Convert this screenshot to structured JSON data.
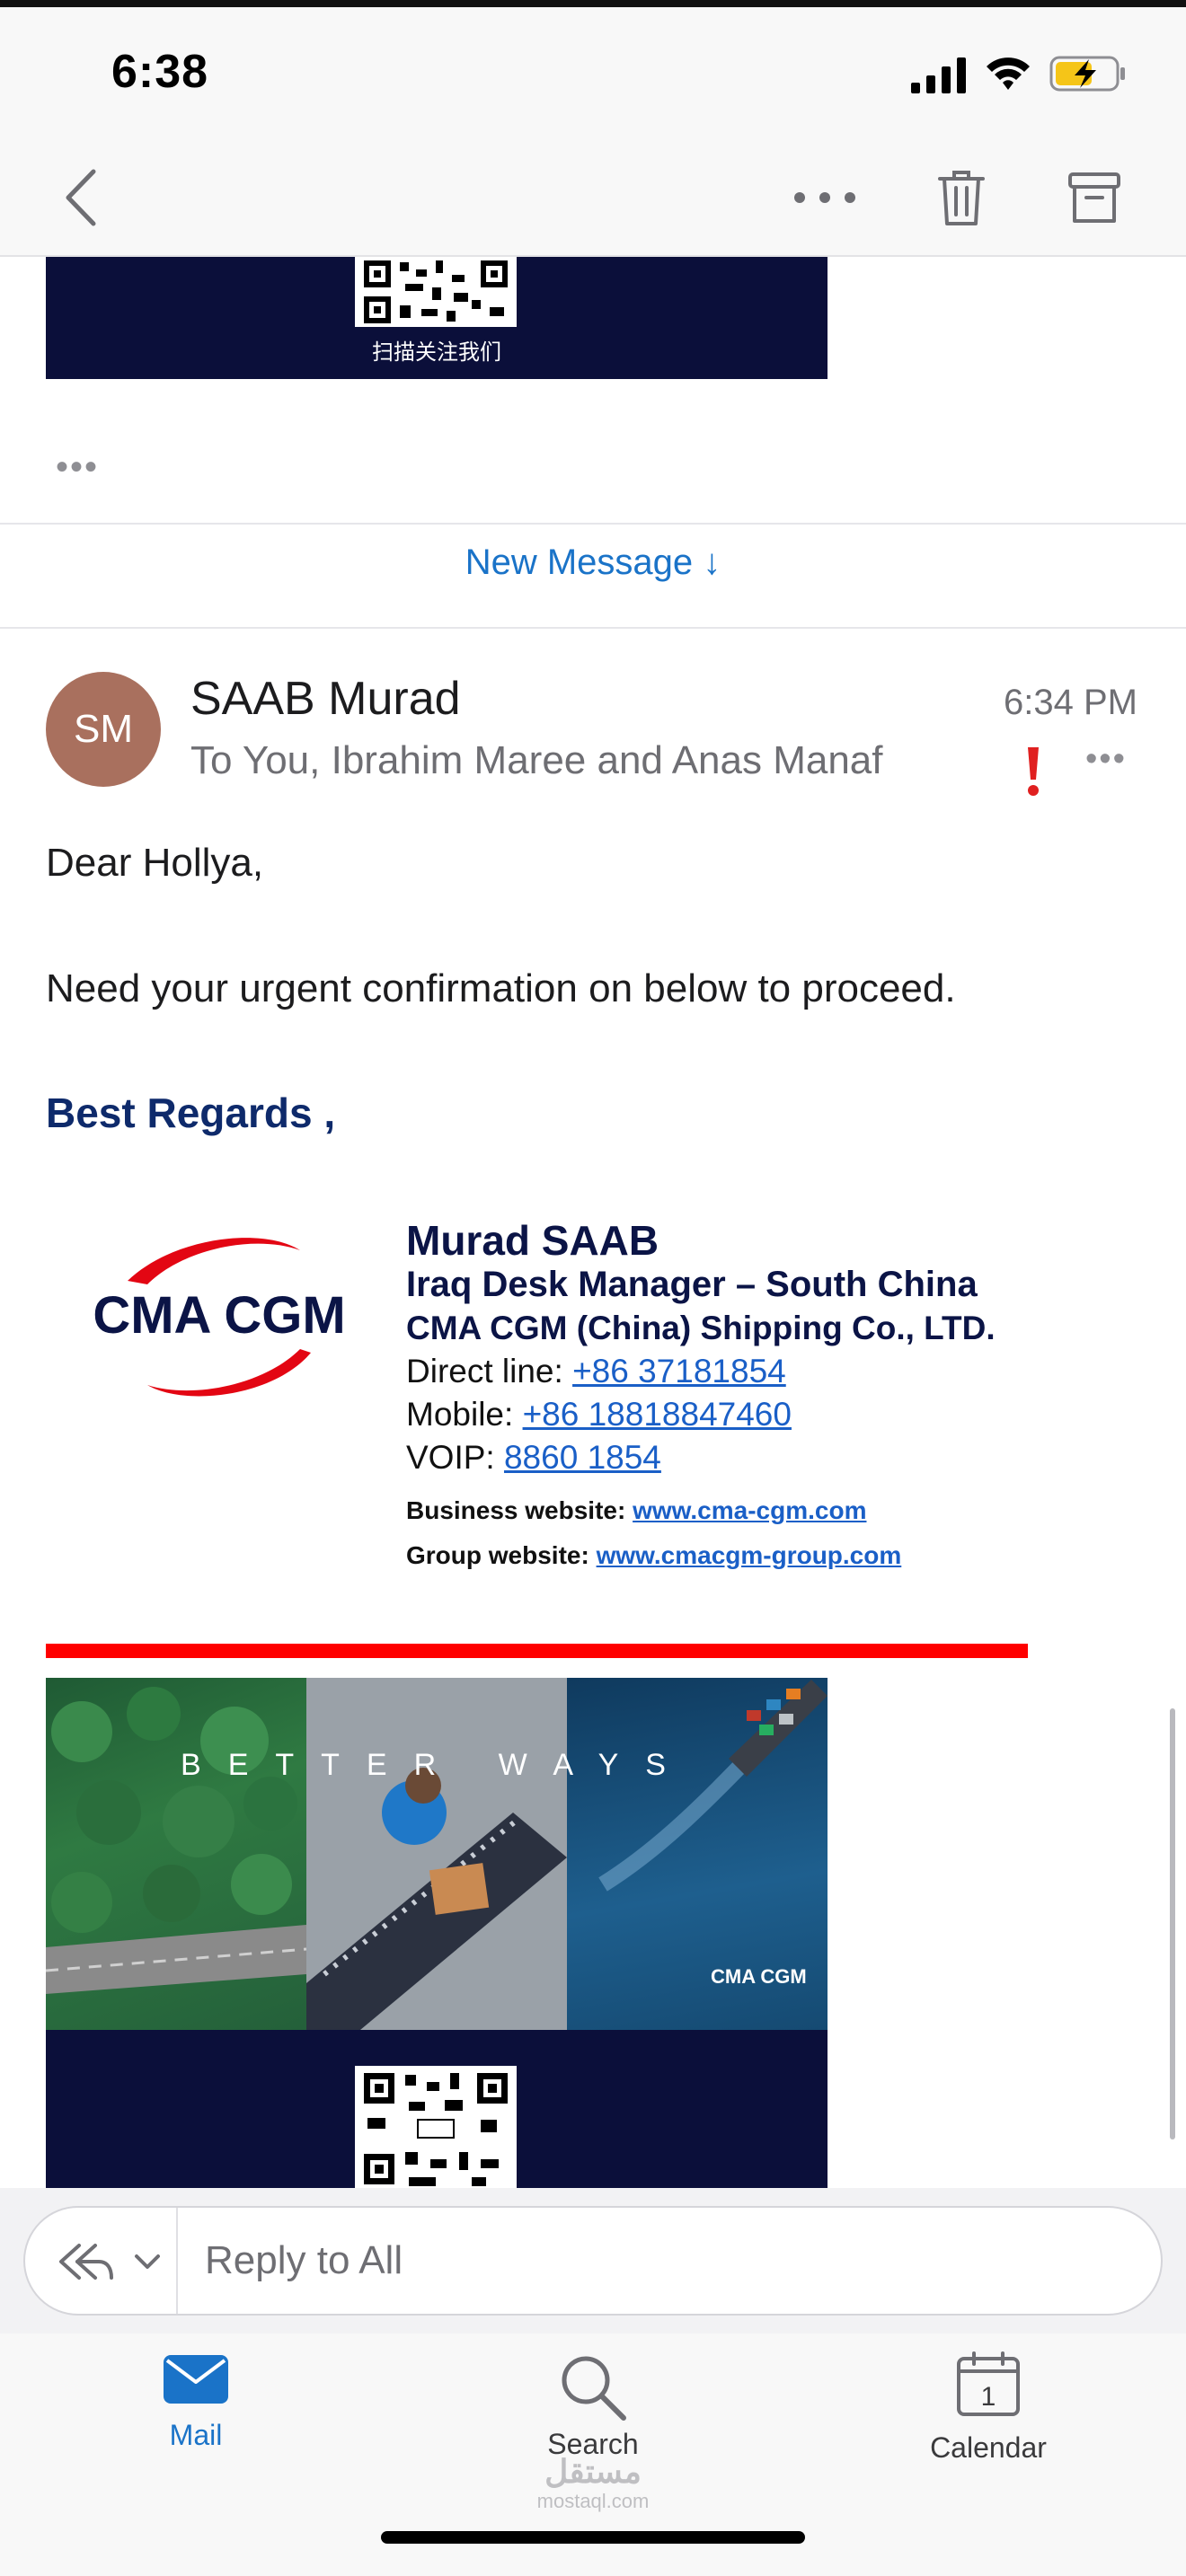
{
  "status_bar": {
    "time": "6:38"
  },
  "nav": {
    "back_icon": "chevron-left-icon",
    "more_icon": "ellipsis-icon",
    "delete_icon": "trash-icon",
    "archive_icon": "archive-icon"
  },
  "previous_message": {
    "qr_caption": "扫描关注我们",
    "collapsed_indicator": "•••"
  },
  "new_message_label": "New Message ↓",
  "message": {
    "avatar_initials": "SM",
    "avatar_color": "#a9705e",
    "sender": "SAAB Murad",
    "recipients": "To You, Ibrahim Maree and Anas Manaf",
    "time": "6:34 PM",
    "more": "•••",
    "greeting": "Dear Hollya,",
    "body": "Need your urgent confirmation on below to proceed.",
    "closing": "Best Regards ,"
  },
  "signature": {
    "logo_text": "CMA CGM",
    "name": "Murad SAAB",
    "role": "Iraq Desk Manager – South China",
    "company": "CMA CGM (China) Shipping Co., LTD.",
    "direct_label": "Direct line: ",
    "direct_value": "+86 37181854",
    "mobile_label": "Mobile: ",
    "mobile_value": "+86 18818847460",
    "voip_label": "VOIP: ",
    "voip_value": "8860 1854",
    "business_label": "Business website: ",
    "business_value": "www.cma-cgm.com",
    "group_label": "Group website: ",
    "group_value": "www.cmacgm-group.com"
  },
  "banner": {
    "text": "BETTER WAYS",
    "logo_text": "CMA CGM"
  },
  "reply": {
    "placeholder": "Reply to All"
  },
  "tabs": [
    {
      "label": "Mail",
      "icon": "mail-icon",
      "active": true
    },
    {
      "label": "Search",
      "icon": "search-icon",
      "active": false
    },
    {
      "label": "Calendar",
      "icon": "calendar-icon",
      "active": false,
      "badge": "1"
    }
  ],
  "watermark": {
    "arabic": "مستقل",
    "latin": "mostaql.com"
  },
  "colors": {
    "accent": "#1a73c8",
    "brand_navy": "#0b0f3a",
    "brand_red": "#e30613",
    "importance": "#e02020"
  }
}
